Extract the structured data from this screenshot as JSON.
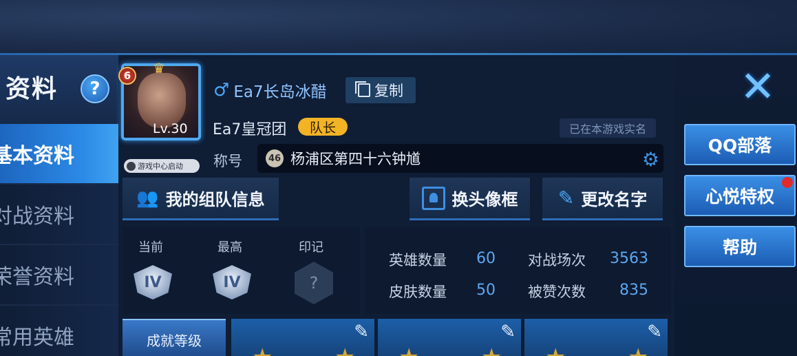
{
  "sidebar": {
    "title": "资料",
    "help": "?",
    "items": [
      {
        "label": "基本资料",
        "active": true
      },
      {
        "label": "对战资料",
        "active": false
      },
      {
        "label": "荣誉资料",
        "active": false
      },
      {
        "label": "常用英雄",
        "active": false
      }
    ]
  },
  "profile": {
    "level_badge": "6",
    "level_text": "Lv.30",
    "game_center": "游戏中心启动",
    "gender_symbol": "♂",
    "name": "Ea7长岛冰醋",
    "copy_label": "复制",
    "clan": "Ea7皇冠团",
    "clan_role": "队长",
    "realname_status": "已在本游戏实名",
    "title_label": "称号",
    "title_num": "46",
    "title_text": "杨浦区第四十六钟馗"
  },
  "buttons": {
    "team_info": "我的组队信息",
    "change_frame": "换头像框",
    "rename": "更改名字"
  },
  "rank": {
    "current_label": "当前",
    "highest_label": "最高",
    "mark_label": "印记",
    "current_tier": "IV",
    "highest_tier": "IV",
    "mark_symbol": "?"
  },
  "stats": {
    "hero_count_label": "英雄数量",
    "hero_count": "60",
    "battles_label": "对战场次",
    "battles": "3563",
    "skin_count_label": "皮肤数量",
    "skin_count": "50",
    "likes_label": "被赞次数",
    "likes": "835"
  },
  "achievement": {
    "tab_label": "成就等级"
  },
  "side": {
    "qq_tribe": "QQ部落",
    "xinyue": "心悦特权",
    "help": "帮助"
  },
  "colors": {
    "accent": "#4aa6f5",
    "active_nav": "#2c8ae6",
    "captain_badge": "#f2b325",
    "notification": "#e12a2a"
  },
  "icons": {
    "close": "close-icon",
    "gear": "gear-icon",
    "copy": "copy-icon",
    "people": "people-icon",
    "frame": "frame-icon",
    "edit": "edit-icon"
  }
}
